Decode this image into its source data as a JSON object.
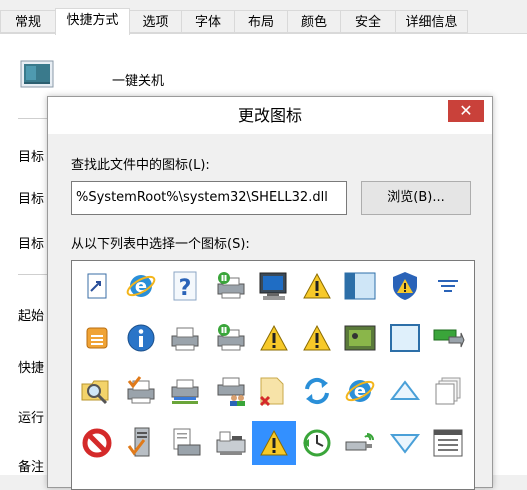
{
  "tabs": [
    "常规",
    "快捷方式",
    "选项",
    "字体",
    "布局",
    "颜色",
    "安全",
    "详细信息"
  ],
  "active_tab_index": 1,
  "shortcut": {
    "name": "一键关机",
    "field_labels": [
      "目标",
      "目标",
      "目标",
      "起始",
      "快捷",
      "运行",
      "备注"
    ]
  },
  "dialog": {
    "title": "更改图标",
    "close_label": "✕",
    "find_label": "查找此文件中的图标(L):",
    "path_value": "%SystemRoot%\\system32\\SHELL32.dll",
    "browse_label": "浏览(B)...",
    "select_label": "从以下列表中选择一个图标(S):",
    "icons": [
      [
        "file-shortcut-icon",
        "ie-globe-icon",
        "help-icon",
        "printer-pause-icon",
        "computer-monitor-icon",
        "warning-icon",
        "window-panel-icon",
        "shield-warning-icon",
        "align-lines-icon"
      ],
      [
        "stack-icon",
        "info-icon",
        "printer-icon",
        "printer-pause-icon",
        "warning-icon",
        "warning-icon",
        "film-camera-icon",
        "blank-window-icon",
        "battery-arrow-icon"
      ],
      [
        "folder-search-icon",
        "printer-check-icon",
        "printer-network-icon",
        "printer-users-icon",
        "folder-delete-icon",
        "refresh-arrows-icon",
        "ie-globe-icon",
        "triangle-up-icon",
        "pages-stack-icon"
      ],
      [
        "no-entry-icon",
        "server-check-icon",
        "document-printer-icon",
        "fax-printer-icon",
        "warning-icon",
        "clock-arrow-icon",
        "usb-wireless-icon",
        "triangle-down-icon",
        "window-grid-icon"
      ]
    ],
    "selected_icon": "row-3-col-4"
  }
}
